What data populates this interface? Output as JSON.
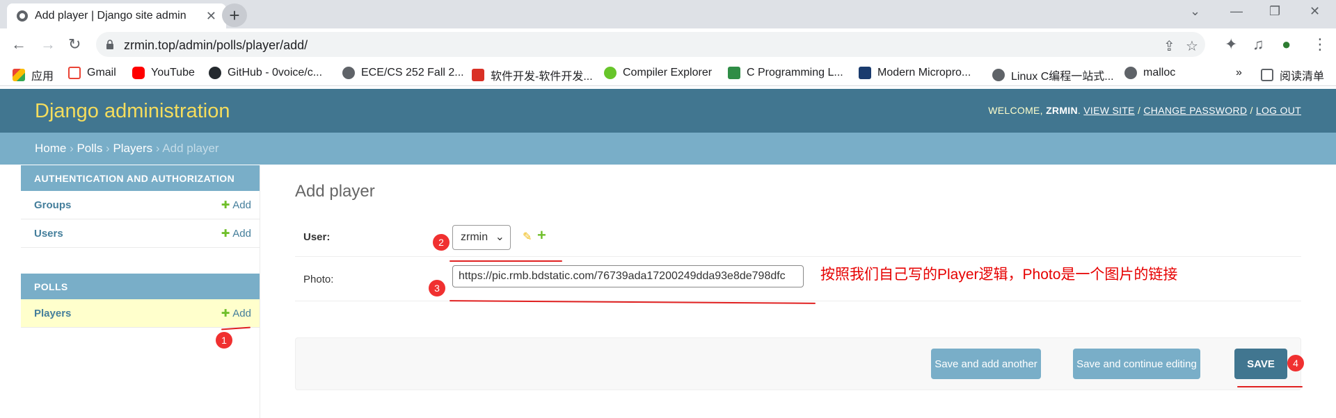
{
  "browser": {
    "tab_title": "Add player | Django site admin",
    "url": "zrmin.top/admin/polls/player/add/",
    "bookmarks": [
      {
        "label": "应用",
        "color": "#ea4335"
      },
      {
        "label": "Gmail",
        "color": "#ea4335"
      },
      {
        "label": "YouTube",
        "color": "#ff0000"
      },
      {
        "label": "GitHub - 0voice/c...",
        "color": "#24292e"
      },
      {
        "label": "ECE/CS 252 Fall 2...",
        "color": "#5f6368"
      },
      {
        "label": "软件开发-软件开发...",
        "color": "#d93025"
      },
      {
        "label": "Compiler Explorer",
        "color": "#67c52a"
      },
      {
        "label": "C Programming L...",
        "color": "#2f8d46"
      },
      {
        "label": "Modern Micropro...",
        "color": "#1a3b6e"
      },
      {
        "label": "Linux C编程一站式...",
        "color": "#5f6368"
      },
      {
        "label": "malloc",
        "color": "#5f6368"
      }
    ],
    "more_bookmarks": "»",
    "reading_list": "阅读清单"
  },
  "admin": {
    "site_title": "Django administration",
    "welcome": "WELCOME,",
    "username": "ZRMIN",
    "view_site": "VIEW SITE",
    "change_password": "CHANGE PASSWORD",
    "log_out": "LOG OUT",
    "breadcrumbs": [
      "Home",
      "Polls",
      "Players",
      "Add player"
    ]
  },
  "sidebar": {
    "auth_caption": "AUTHENTICATION AND AUTHORIZATION",
    "auth_models": [
      {
        "name": "Groups",
        "add": "Add"
      },
      {
        "name": "Users",
        "add": "Add"
      }
    ],
    "polls_caption": "POLLS",
    "polls_models": [
      {
        "name": "Players",
        "add": "Add"
      }
    ]
  },
  "form": {
    "title": "Add player",
    "user_label": "User:",
    "user_value": "zrmin",
    "photo_label": "Photo:",
    "photo_value": "https://pic.rmb.bdstatic.com/76739ada17200249dda93e8de798dfc",
    "annotation": "按照我们自己写的Player逻辑，Photo是一个图片的链接",
    "save_add_another": "Save and add another",
    "save_continue": "Save and continue editing",
    "save": "SAVE"
  },
  "markers": [
    "1",
    "2",
    "3",
    "4"
  ],
  "colors": {
    "header": "#417690",
    "breadcrumbs": "#79aec8",
    "branding": "#f5dd5d",
    "highlight_row": "#ffffcc",
    "markup_red": "#f03030"
  }
}
